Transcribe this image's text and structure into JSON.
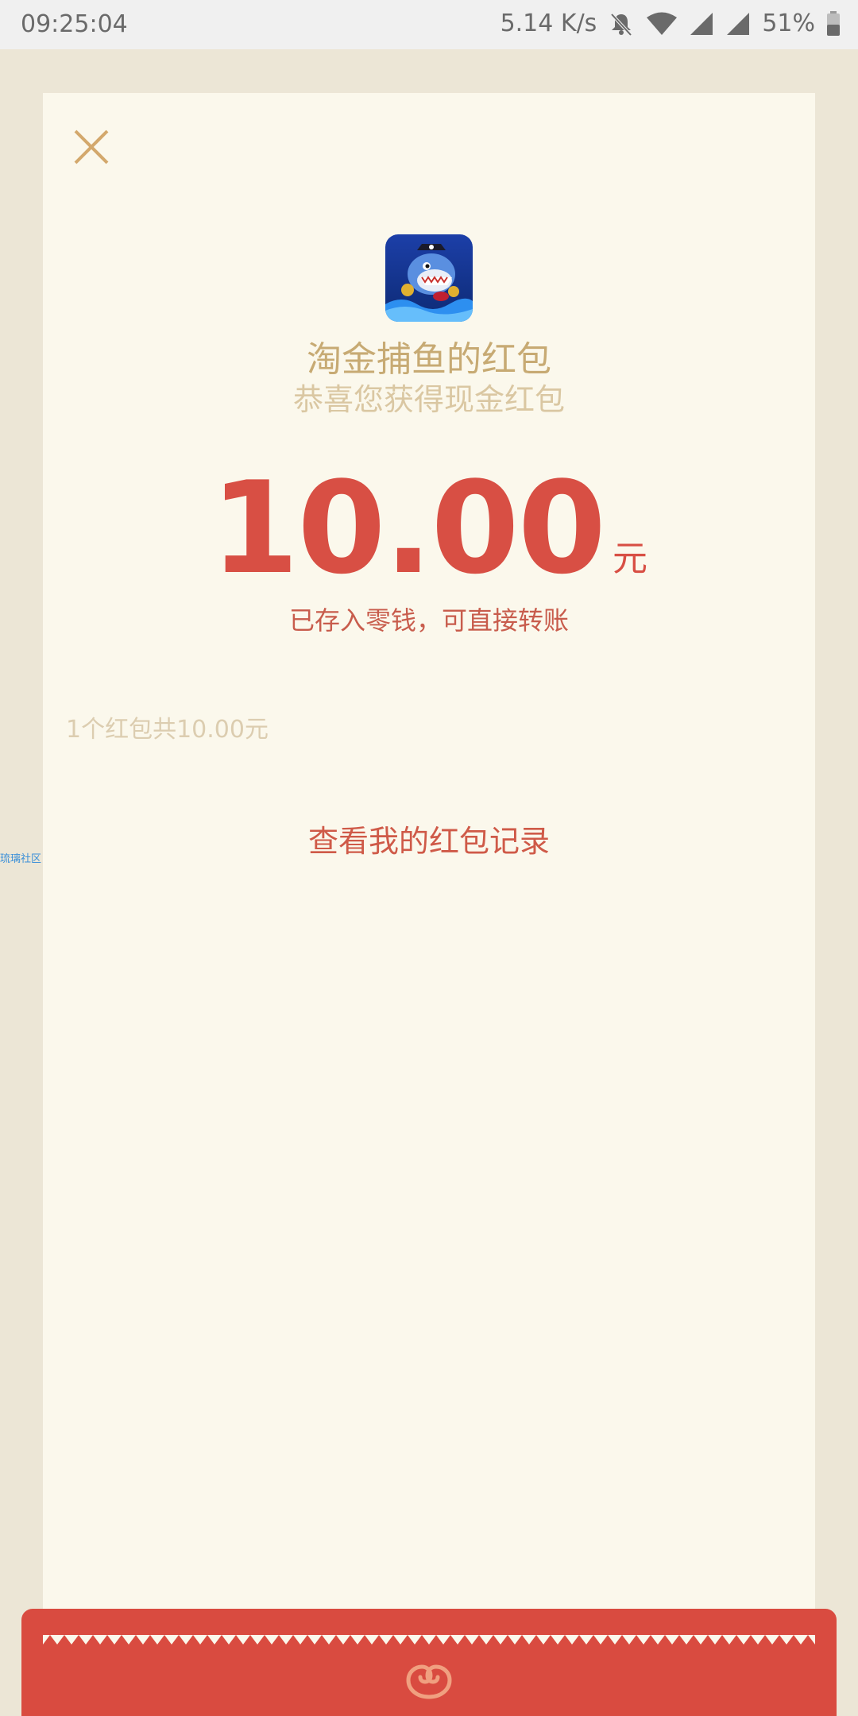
{
  "status_bar": {
    "time": "09:25:04",
    "speed": "5.14 K/s",
    "battery": "51%",
    "icons": [
      "mute-bell-icon",
      "wifi-icon",
      "signal-icon",
      "signal-icon",
      "battery-icon"
    ]
  },
  "red_packet": {
    "sender_title": "淘金捕鱼的红包",
    "sender_subtitle": "恭喜您获得现金红包",
    "amount": "10.00",
    "unit": "元",
    "note": "已存入零钱，可直接转账",
    "summary": "1个红包共10.00元",
    "record_link": "查看我的红包记录"
  },
  "watermark": "琉璃社区",
  "colors": {
    "accent_red": "#d84f44",
    "gold": "#c7aa73",
    "card_bg": "#fbf8ec",
    "page_bg": "#ece6d6"
  }
}
